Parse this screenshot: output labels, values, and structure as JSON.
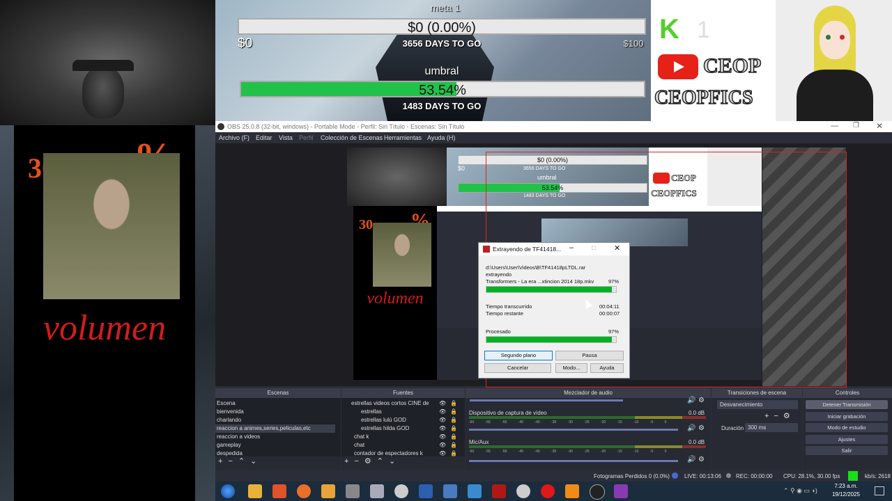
{
  "banner": {
    "goal1_label": "meta 1",
    "goal1_value": "$0 (0.00%)",
    "goal1_left": "$0",
    "goal1_days": "3656 DAYS TO GO",
    "goal1_right": "$100",
    "goal1_progress": 0.0,
    "goal2_label": "umbral",
    "goal2_value": "53.54%",
    "goal2_days": "1483 DAYS TO GO",
    "goal2_progress": 0.5354,
    "brand_k": "K",
    "brand_count": "1",
    "brand_ceop": "CEOP",
    "brand_ceopfics": "CEOPFICS"
  },
  "left_overlay": {
    "percent_number": "30",
    "percent_sign": "%",
    "caption": "volumen"
  },
  "obs": {
    "title": "OBS 25.0.8 (32-bit, windows) - Portable Mode - Perfil: Sin Título - Escenas: Sin Título",
    "menu": [
      "Archivo (F)",
      "Editar",
      "Vista",
      "Perfil",
      "Colección de Escenas",
      "Herramientas",
      "Ayuda (H)"
    ],
    "docks": {
      "scenes_title": "Escenas",
      "sources_title": "Fuentes",
      "mixer_title": "Mezclador de audio",
      "transitions_title": "Transiciones de escena",
      "controls_title": "Controles"
    },
    "scenes": [
      "Escena",
      "bienvenida",
      "charlando",
      "reaccion a animes,series,peliculas,etc",
      "reaccion a videos",
      "gameplay",
      "despedida"
    ],
    "sources": [
      "estrellas videos cortos CINE de",
      "estrellas",
      "estrellas lulú GOD",
      "estrellas hilda GOD",
      "chat k",
      "chat",
      "contador de espectadores k"
    ],
    "mixer": {
      "ch1_name": "Dispositivo de captura de vídeo",
      "ch1_db": "0.0 dB",
      "ch2_name": "Mic/Aux",
      "ch2_db": "0.0 dB",
      "scale": [
        "-60",
        "-55",
        "-50",
        "-45",
        "-40",
        "-35",
        "-30",
        "-25",
        "-20",
        "-15",
        "-10",
        "-5",
        "0"
      ]
    },
    "transitions": {
      "type": "Desvanecimiento",
      "duration_label": "Duración",
      "duration_value": "300 ms"
    },
    "controls": [
      "Detener Transmisión",
      "Iniciar grabación",
      "Modo de estudio",
      "Ajustes",
      "Salir"
    ],
    "status": {
      "dropped": "Fotogramas Perdidos 0 (0.0%)",
      "live": "LIVE: 00:13:06",
      "rec": "REC: 00:00:00",
      "cpu": "CPU: 28.1%, 30.00 fps",
      "kbs": "kb/s: 2618"
    }
  },
  "preview_mini": {
    "goal1_value": "$0 (0.00%)",
    "goal1_left": "$0",
    "goal1_days": "3656 DAYS TO GO",
    "goal2_label": "umbral",
    "goal2_value": "53.54%",
    "goal2_days": "1483 DAYS TO GO",
    "brand_ceop": "CEOP",
    "brand_ceopfics": "CEOPFICS",
    "percent_number": "30",
    "percent_sign": "%",
    "caption": "volumen"
  },
  "dialog": {
    "title": "Extrayendo de TF41418...",
    "archive_path": "d:\\Users\\User\\Videos\\B\\TF41418pLTDL.rar",
    "action": "extrayendo",
    "file_name": "Transformers - La era ...xtincion 2014 18p.mkv",
    "file_percent": "97%",
    "file_progress": 0.97,
    "elapsed_label": "Tiempo transcurrido",
    "elapsed_value": "00:04:11",
    "remaining_label": "Tiempo restante",
    "remaining_value": "00:00:07",
    "processed_label": "Procesado",
    "processed_percent": "97%",
    "processed_progress": 0.97,
    "btn_background": "Segundo plano",
    "btn_pause": "Pausa",
    "btn_cancel": "Cancelar",
    "btn_mode": "Modo...",
    "btn_help": "Ayuda"
  },
  "taskbar": {
    "time": "7:23 a.m.",
    "date": "19/12/2025"
  },
  "colors": {
    "accent_green": "#22c24a",
    "youtube_red": "#e62117",
    "obs_bg": "#2b2e38",
    "overlay_red": "#d01c1c"
  }
}
